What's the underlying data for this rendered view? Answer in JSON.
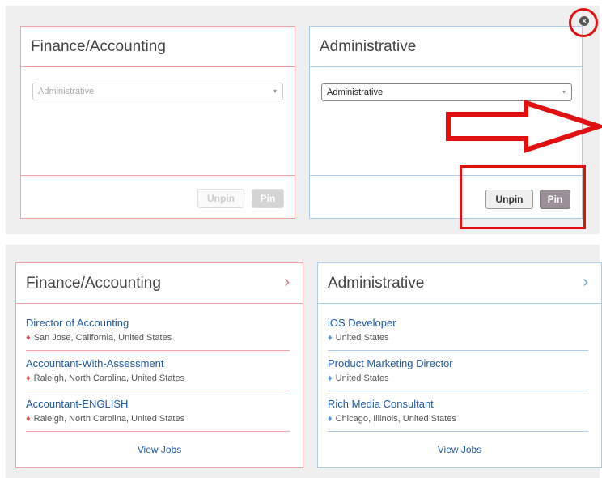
{
  "colors": {
    "red_border": "#f0a3a3",
    "blue_border": "#aecdee",
    "link": "#1f5aa6",
    "annotation_red": "#e01010"
  },
  "top": {
    "left_card": {
      "title": "Finance/Accounting",
      "select_value": "Administrative",
      "unpin_label": "Unpin",
      "pin_label": "Pin"
    },
    "right_card": {
      "title": "Administrative",
      "select_value": "Administrative",
      "unpin_label": "Unpin",
      "pin_label": "Pin"
    },
    "close_icon": "close-icon",
    "caret": "▾"
  },
  "bottom": {
    "left_card": {
      "title": "Finance/Accounting",
      "jobs": [
        {
          "title": "Director of Accounting",
          "location": "San Jose, California, United States"
        },
        {
          "title": "Accountant-With-Assessment",
          "location": "Raleigh, North Carolina, United States"
        },
        {
          "title": "Accountant-ENGLISH",
          "location": "Raleigh, North Carolina, United States"
        }
      ],
      "view_jobs": "View Jobs"
    },
    "right_card": {
      "title": "Administrative",
      "jobs": [
        {
          "title": "iOS Developer",
          "location": "United States"
        },
        {
          "title": "Product Marketing Director",
          "location": "United States"
        },
        {
          "title": "Rich Media Consultant",
          "location": "Chicago, Illinois, United States"
        }
      ],
      "view_jobs": "View Jobs"
    },
    "chevron": "›"
  }
}
